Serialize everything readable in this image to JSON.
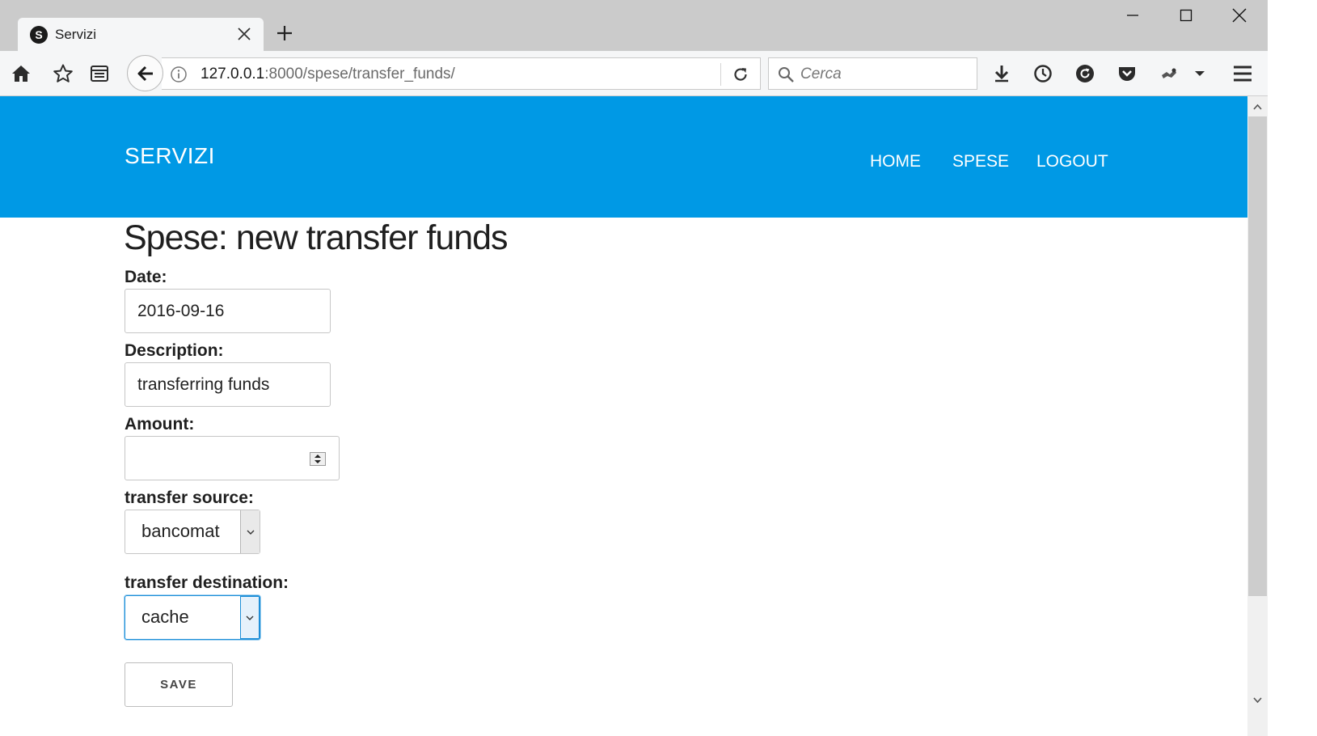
{
  "browser": {
    "tab": {
      "favicon_letter": "S",
      "title": "Servizi"
    },
    "address": {
      "host": "127.0.0.1",
      "rest": ":8000/spese/transfer_funds/"
    },
    "search": {
      "placeholder": "Cerca"
    }
  },
  "site": {
    "brand": "SERVIZI",
    "nav": [
      "HOME",
      "SPESE",
      "LOGOUT"
    ],
    "header_color": "#0099e5"
  },
  "page": {
    "title": "Spese: new transfer funds"
  },
  "form": {
    "date": {
      "label": "Date:",
      "value": "2016-09-16"
    },
    "description": {
      "label": "Description:",
      "value": "transferring funds"
    },
    "amount": {
      "label": "Amount:",
      "value": ""
    },
    "source": {
      "label": "transfer source:",
      "selected": "bancomat"
    },
    "destination": {
      "label": "transfer destination:",
      "selected": "cache"
    },
    "save_label": "SAVE"
  }
}
